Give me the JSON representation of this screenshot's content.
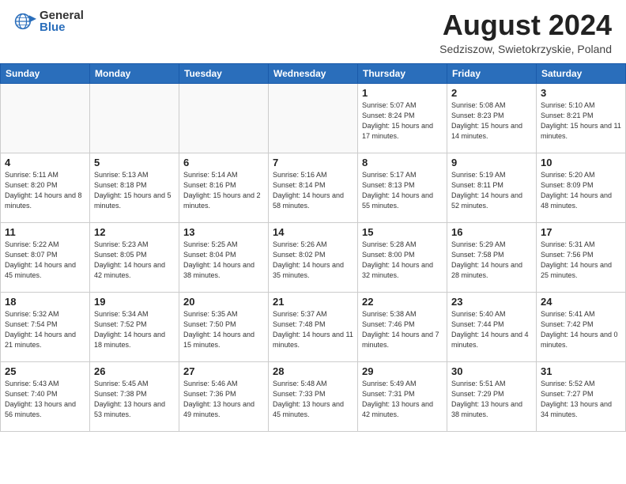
{
  "header": {
    "logo_general": "General",
    "logo_blue": "Blue",
    "month_year": "August 2024",
    "location": "Sedziszow, Swietokrzyskie, Poland"
  },
  "weekdays": [
    "Sunday",
    "Monday",
    "Tuesday",
    "Wednesday",
    "Thursday",
    "Friday",
    "Saturday"
  ],
  "weeks": [
    [
      {
        "day": "",
        "empty": true
      },
      {
        "day": "",
        "empty": true
      },
      {
        "day": "",
        "empty": true
      },
      {
        "day": "",
        "empty": true
      },
      {
        "day": "1",
        "sunrise": "5:07 AM",
        "sunset": "8:24 PM",
        "daylight": "15 hours and 17 minutes."
      },
      {
        "day": "2",
        "sunrise": "5:08 AM",
        "sunset": "8:23 PM",
        "daylight": "15 hours and 14 minutes."
      },
      {
        "day": "3",
        "sunrise": "5:10 AM",
        "sunset": "8:21 PM",
        "daylight": "15 hours and 11 minutes."
      }
    ],
    [
      {
        "day": "4",
        "sunrise": "5:11 AM",
        "sunset": "8:20 PM",
        "daylight": "14 hours and 8 minutes."
      },
      {
        "day": "5",
        "sunrise": "5:13 AM",
        "sunset": "8:18 PM",
        "daylight": "15 hours and 5 minutes."
      },
      {
        "day": "6",
        "sunrise": "5:14 AM",
        "sunset": "8:16 PM",
        "daylight": "15 hours and 2 minutes."
      },
      {
        "day": "7",
        "sunrise": "5:16 AM",
        "sunset": "8:14 PM",
        "daylight": "14 hours and 58 minutes."
      },
      {
        "day": "8",
        "sunrise": "5:17 AM",
        "sunset": "8:13 PM",
        "daylight": "14 hours and 55 minutes."
      },
      {
        "day": "9",
        "sunrise": "5:19 AM",
        "sunset": "8:11 PM",
        "daylight": "14 hours and 52 minutes."
      },
      {
        "day": "10",
        "sunrise": "5:20 AM",
        "sunset": "8:09 PM",
        "daylight": "14 hours and 48 minutes."
      }
    ],
    [
      {
        "day": "11",
        "sunrise": "5:22 AM",
        "sunset": "8:07 PM",
        "daylight": "14 hours and 45 minutes."
      },
      {
        "day": "12",
        "sunrise": "5:23 AM",
        "sunset": "8:05 PM",
        "daylight": "14 hours and 42 minutes."
      },
      {
        "day": "13",
        "sunrise": "5:25 AM",
        "sunset": "8:04 PM",
        "daylight": "14 hours and 38 minutes."
      },
      {
        "day": "14",
        "sunrise": "5:26 AM",
        "sunset": "8:02 PM",
        "daylight": "14 hours and 35 minutes."
      },
      {
        "day": "15",
        "sunrise": "5:28 AM",
        "sunset": "8:00 PM",
        "daylight": "14 hours and 32 minutes."
      },
      {
        "day": "16",
        "sunrise": "5:29 AM",
        "sunset": "7:58 PM",
        "daylight": "14 hours and 28 minutes."
      },
      {
        "day": "17",
        "sunrise": "5:31 AM",
        "sunset": "7:56 PM",
        "daylight": "14 hours and 25 minutes."
      }
    ],
    [
      {
        "day": "18",
        "sunrise": "5:32 AM",
        "sunset": "7:54 PM",
        "daylight": "14 hours and 21 minutes."
      },
      {
        "day": "19",
        "sunrise": "5:34 AM",
        "sunset": "7:52 PM",
        "daylight": "14 hours and 18 minutes."
      },
      {
        "day": "20",
        "sunrise": "5:35 AM",
        "sunset": "7:50 PM",
        "daylight": "14 hours and 15 minutes."
      },
      {
        "day": "21",
        "sunrise": "5:37 AM",
        "sunset": "7:48 PM",
        "daylight": "14 hours and 11 minutes."
      },
      {
        "day": "22",
        "sunrise": "5:38 AM",
        "sunset": "7:46 PM",
        "daylight": "14 hours and 7 minutes."
      },
      {
        "day": "23",
        "sunrise": "5:40 AM",
        "sunset": "7:44 PM",
        "daylight": "14 hours and 4 minutes."
      },
      {
        "day": "24",
        "sunrise": "5:41 AM",
        "sunset": "7:42 PM",
        "daylight": "14 hours and 0 minutes."
      }
    ],
    [
      {
        "day": "25",
        "sunrise": "5:43 AM",
        "sunset": "7:40 PM",
        "daylight": "13 hours and 56 minutes."
      },
      {
        "day": "26",
        "sunrise": "5:45 AM",
        "sunset": "7:38 PM",
        "daylight": "13 hours and 53 minutes."
      },
      {
        "day": "27",
        "sunrise": "5:46 AM",
        "sunset": "7:36 PM",
        "daylight": "13 hours and 49 minutes."
      },
      {
        "day": "28",
        "sunrise": "5:48 AM",
        "sunset": "7:33 PM",
        "daylight": "13 hours and 45 minutes."
      },
      {
        "day": "29",
        "sunrise": "5:49 AM",
        "sunset": "7:31 PM",
        "daylight": "13 hours and 42 minutes."
      },
      {
        "day": "30",
        "sunrise": "5:51 AM",
        "sunset": "7:29 PM",
        "daylight": "13 hours and 38 minutes."
      },
      {
        "day": "31",
        "sunrise": "5:52 AM",
        "sunset": "7:27 PM",
        "daylight": "13 hours and 34 minutes."
      }
    ]
  ],
  "labels": {
    "sunrise": "Sunrise:",
    "sunset": "Sunset:",
    "daylight": "Daylight:"
  }
}
